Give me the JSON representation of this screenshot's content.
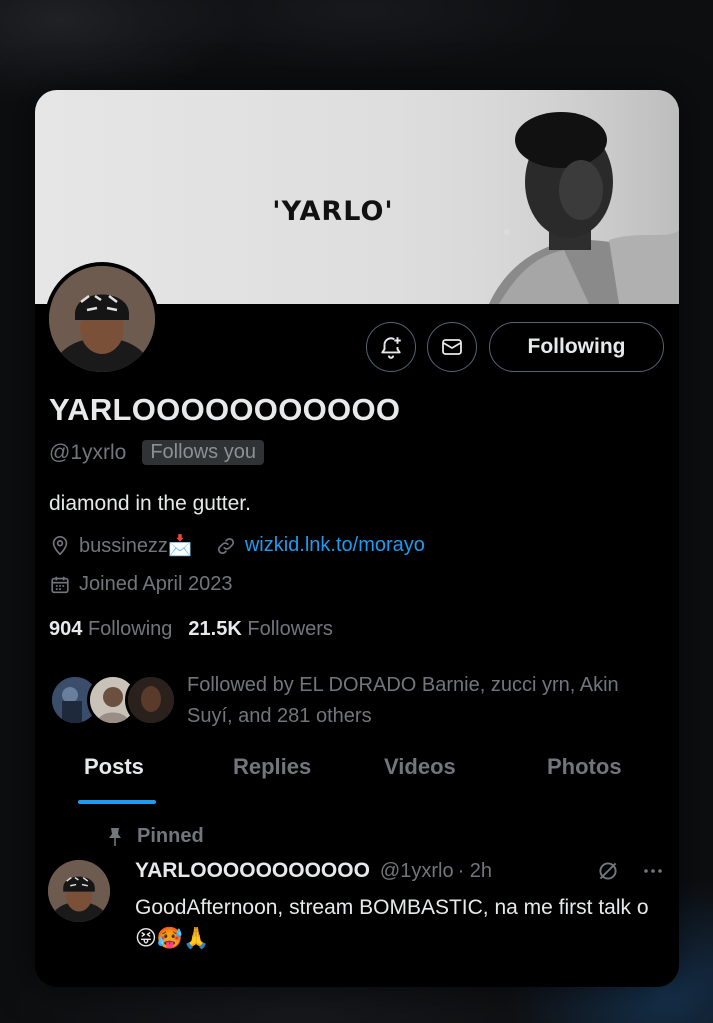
{
  "banner": {
    "title": "'YARLO'"
  },
  "profile": {
    "display_name": "YARLOOOOOOOOOOO",
    "handle": "@1yxrlo",
    "follows_you_badge": "Follows you",
    "bio": "diamond in the gutter.",
    "location": "bussinezz📩",
    "website": "wizkid.lnk.to/morayo",
    "joined": "Joined April 2023"
  },
  "actions": {
    "follow_label": "Following"
  },
  "stats": {
    "following_count": "904",
    "following_label": "Following",
    "followers_count": "21.5K",
    "followers_label": "Followers"
  },
  "followed_by": {
    "text": "Followed by EL DORADO Barnie, zucci yrn, Akin Suyí, and 281 others"
  },
  "tabs": [
    "Posts",
    "Replies",
    "Videos",
    "Photos"
  ],
  "pinned_post": {
    "pinned_label": "Pinned",
    "author_name": "YARLOOOOOOOOOOO",
    "author_handle": "@1yxrlo",
    "time": "· 2h",
    "text": "GoodAfternoon, stream BOMBASTIC, na me first talk o😝🥵🙏"
  },
  "colors": {
    "accent": "#1d9bf0",
    "background": "#000000",
    "muted": "#71767b",
    "text": "#e7e9ea"
  }
}
